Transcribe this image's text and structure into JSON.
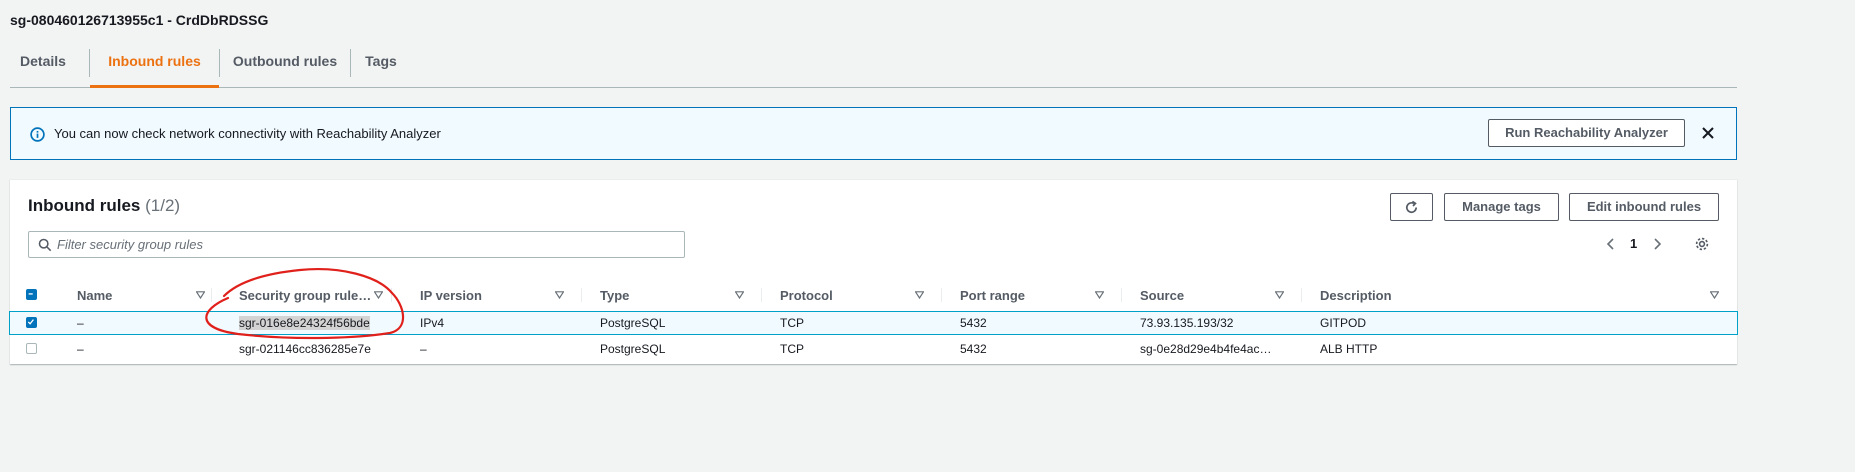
{
  "page": {
    "title": "sg-080460126713955c1 - CrdDbRDSSG"
  },
  "tabs": [
    {
      "label": "Details",
      "active": false
    },
    {
      "label": "Inbound rules",
      "active": true
    },
    {
      "label": "Outbound rules",
      "active": false
    },
    {
      "label": "Tags",
      "active": false
    }
  ],
  "flash": {
    "message": "You can now check network connectivity with Reachability Analyzer",
    "button_label": "Run Reachability Analyzer",
    "icon": "info-icon",
    "close_icon": "close-icon"
  },
  "panel": {
    "title": "Inbound rules",
    "count": "(1/2)",
    "refresh_icon": "refresh-icon",
    "manage_tags_label": "Manage tags",
    "edit_label": "Edit inbound rules"
  },
  "filter": {
    "placeholder": "Filter security group rules",
    "value": ""
  },
  "pagination": {
    "current_page": "1"
  },
  "table": {
    "columns": [
      "Name",
      "Security group rule…",
      "IP version",
      "Type",
      "Protocol",
      "Port range",
      "Source",
      "Description"
    ],
    "rows": [
      {
        "selected": true,
        "name": "–",
        "rule_id": "sgr-016e8e24324f56bde",
        "ip_version": "IPv4",
        "type": "PostgreSQL",
        "protocol": "TCP",
        "port_range": "5432",
        "source": "73.93.135.193/32",
        "description": "GITPOD"
      },
      {
        "selected": false,
        "name": "–",
        "rule_id": "sgr-021146cc836285e7e",
        "ip_version": "–",
        "type": "PostgreSQL",
        "protocol": "TCP",
        "port_range": "5432",
        "source": "sg-0e28d29e4b4fe4ac…",
        "description": "ALB HTTP"
      }
    ]
  },
  "colors": {
    "accent": "#ec7211",
    "link": "#0073bb",
    "annotation": "#e0201b"
  }
}
